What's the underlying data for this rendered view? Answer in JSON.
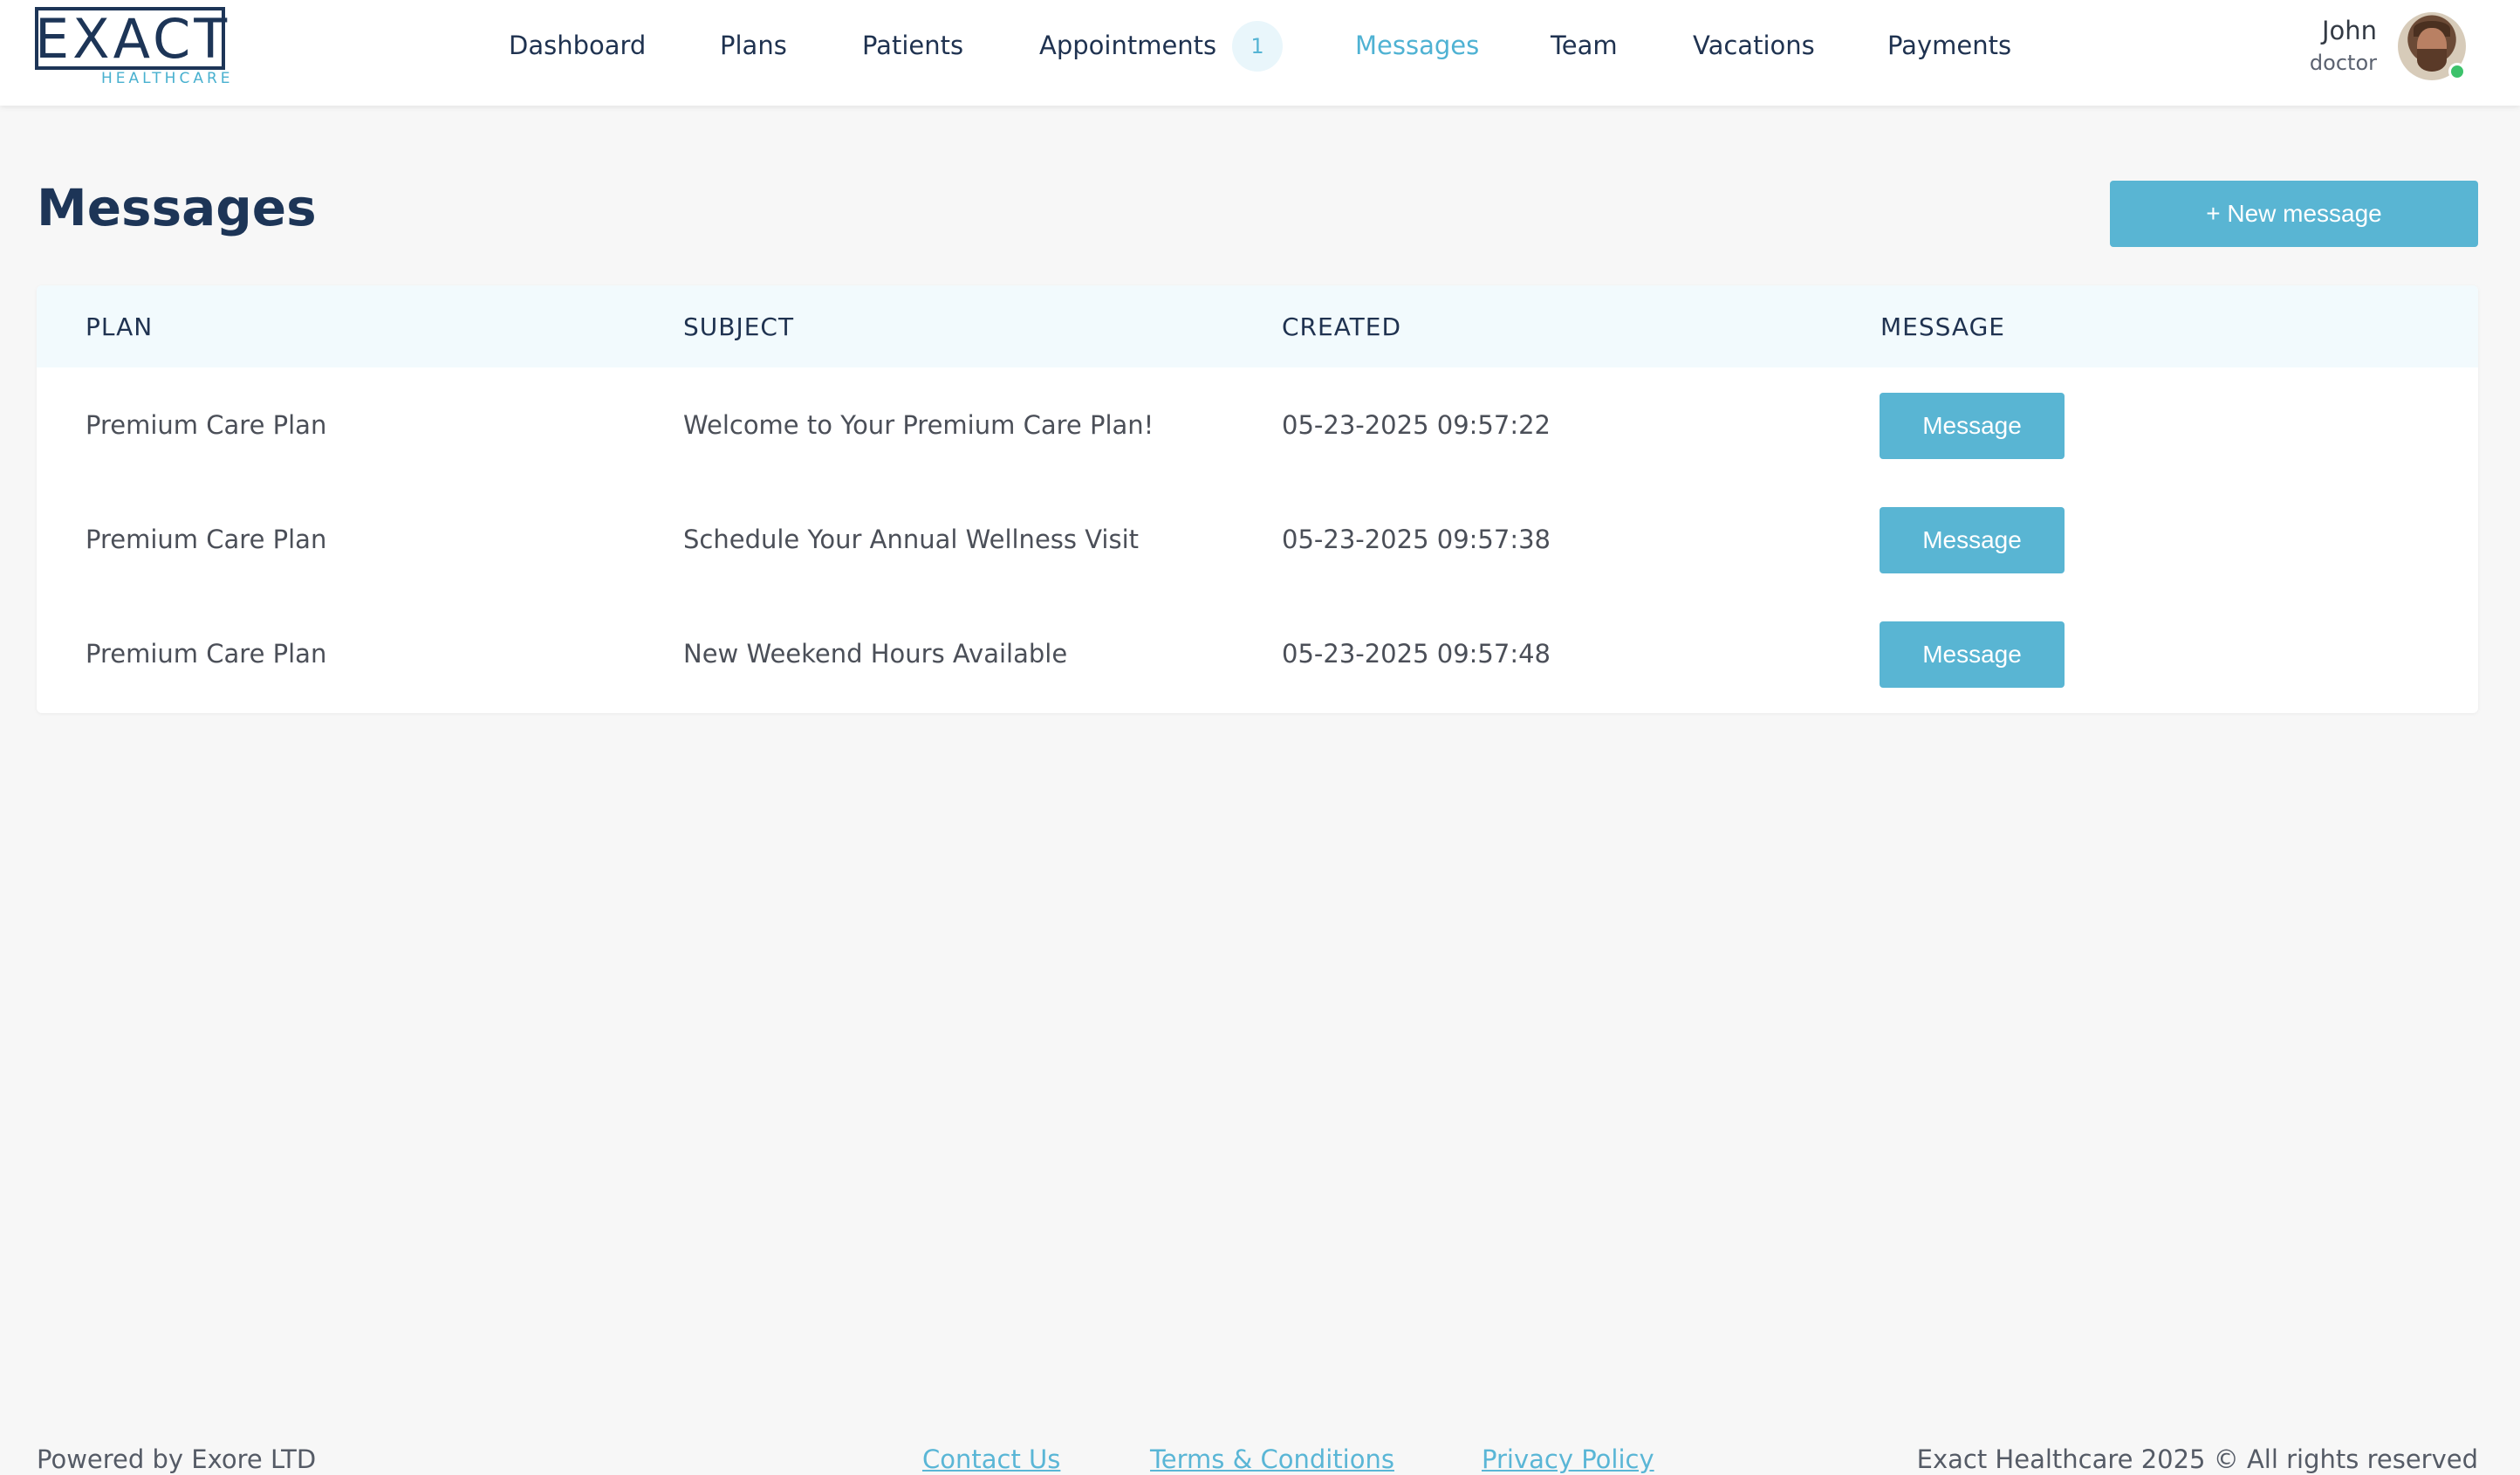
{
  "brand": {
    "logo_word": "EXACT",
    "logo_sub": "HEALTHCARE"
  },
  "nav": {
    "items": [
      "Dashboard",
      "Plans",
      "Patients",
      "Appointments",
      "Messages",
      "Team",
      "Vacations",
      "Payments"
    ],
    "active": "Messages",
    "appointments_badge": "1"
  },
  "user": {
    "name": "John",
    "role": "doctor",
    "status": "online"
  },
  "page": {
    "title": "Messages",
    "new_button": "+ New message"
  },
  "table": {
    "columns": [
      "PLAN",
      "SUBJECT",
      "CREATED",
      "MESSAGE"
    ],
    "rows": [
      {
        "plan": "Premium Care Plan",
        "subject": "Welcome to Your Premium Care Plan!",
        "created": "05-23-2025 09:57:22",
        "action": "Message"
      },
      {
        "plan": "Premium Care Plan",
        "subject": "Schedule Your Annual Wellness Visit",
        "created": "05-23-2025 09:57:38",
        "action": "Message"
      },
      {
        "plan": "Premium Care Plan",
        "subject": "New Weekend Hours Available",
        "created": "05-23-2025 09:57:48",
        "action": "Message"
      }
    ]
  },
  "footer": {
    "powered_by": "Powered by Exore LTD",
    "links": [
      "Contact Us",
      "Terms & Conditions",
      "Privacy Policy"
    ],
    "copyright": "Exact Healthcare 2025 © All rights reserved"
  },
  "colors": {
    "accent": "#59b5d3",
    "navy": "#1d3557",
    "online": "#3cc26b"
  }
}
